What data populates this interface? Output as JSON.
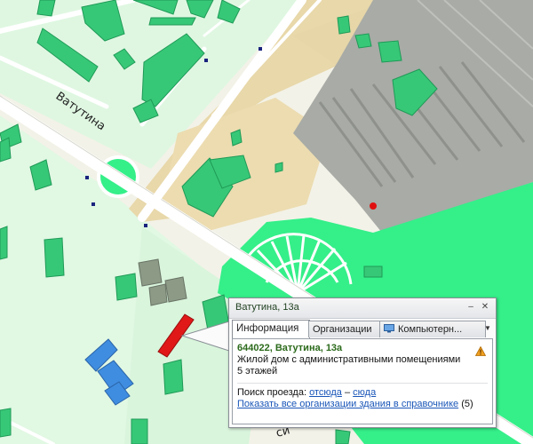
{
  "map": {
    "street_label": "Ватутина",
    "street_label_partial": "си"
  },
  "popup": {
    "title": "Ватутина, 13а",
    "tabs": [
      {
        "label": "Информация"
      },
      {
        "label": "Организации"
      },
      {
        "label": "Компьютерн..."
      }
    ],
    "address": "644022, Ватутина, 13а",
    "description": "Жилой дом с административными помещениями",
    "floors": "5 этажей",
    "route_prefix": "Поиск проезда:",
    "route_from": "отсюда",
    "route_dash": "–",
    "route_to": "сюда",
    "show_orgs_link": "Показать все организации здания в справочнике",
    "orgs_count": "(5)"
  },
  "colors": {
    "park": "#33f08a",
    "building": "#35c77a",
    "industrial": "#a6a9a4",
    "sand": "#e9d9ae",
    "selected_building": "#e01818",
    "marker": "#e01010"
  }
}
